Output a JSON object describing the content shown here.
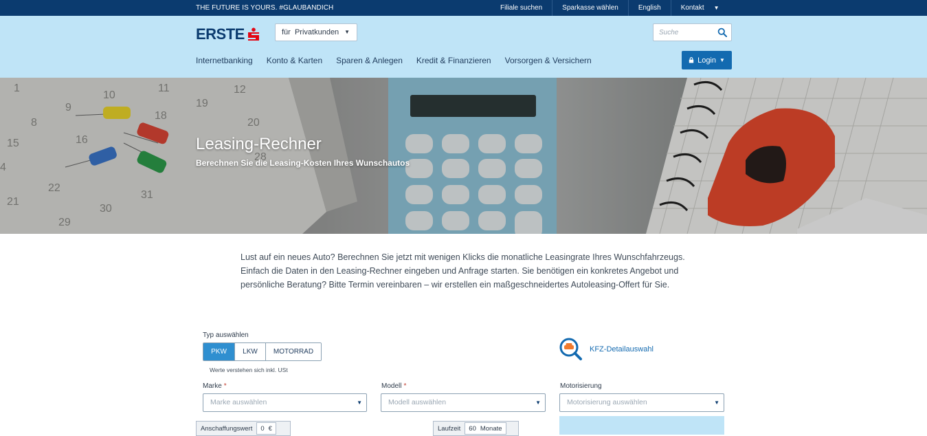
{
  "topbar": {
    "tagline": "THE FUTURE IS YOURS. #GLAUBANDICH",
    "links": [
      "Filiale suchen",
      "Sparkasse wählen",
      "English",
      "Kontakt"
    ]
  },
  "header": {
    "logo_text": "ERSTE",
    "segment_prefix": "für",
    "segment_value": "Privatkunden",
    "search_placeholder": "Suche",
    "nav": [
      "Internetbanking",
      "Konto & Karten",
      "Sparen & Anlegen",
      "Kredit & Finanzieren",
      "Vorsorgen & Versichern"
    ],
    "login_label": "Login"
  },
  "hero": {
    "title": "Leasing-Rechner",
    "subtitle": "Berechnen Sie die Leasing-Kosten Ihres Wunschautos"
  },
  "intro": "Lust auf ein neues Auto? Berechnen Sie jetzt mit wenigen Klicks die monatliche Leasingrate Ihres Wunschfahrzeugs. Einfach die Daten in den Leasing-Rechner eingeben und Anfrage starten. Sie benötigen ein konkretes Angebot und persönliche Beratung? Bitte Termin vereinbaren – wir erstellen ein maßgeschneidertes Autoleasing-Offert für Sie.",
  "form": {
    "type_label": "Typ auswählen",
    "types": [
      "PKW",
      "LKW",
      "MOTORRAD"
    ],
    "active_type": "PKW",
    "note": "Werte verstehen sich inkl. USt",
    "kfz_link": "KFZ-Detailauswahl",
    "marke_label": "Marke",
    "marke_placeholder": "Marke auswählen",
    "modell_label": "Modell",
    "modell_placeholder": "Modell auswählen",
    "motor_label": "Motorisierung",
    "motor_placeholder": "Motorisierung auswählen",
    "required_mark": "*",
    "anschaffung_label": "Anschaffungswert",
    "anschaffung_value": "0",
    "anschaffung_unit": "€",
    "laufzeit_label": "Laufzeit",
    "laufzeit_value": "60",
    "laufzeit_unit": "Monate"
  },
  "colors": {
    "topbar": "#0b3b6f",
    "header": "#bfe4f7",
    "accent": "#136ab0",
    "active_toggle": "#2f8fd0",
    "logo_red": "#e30613"
  }
}
